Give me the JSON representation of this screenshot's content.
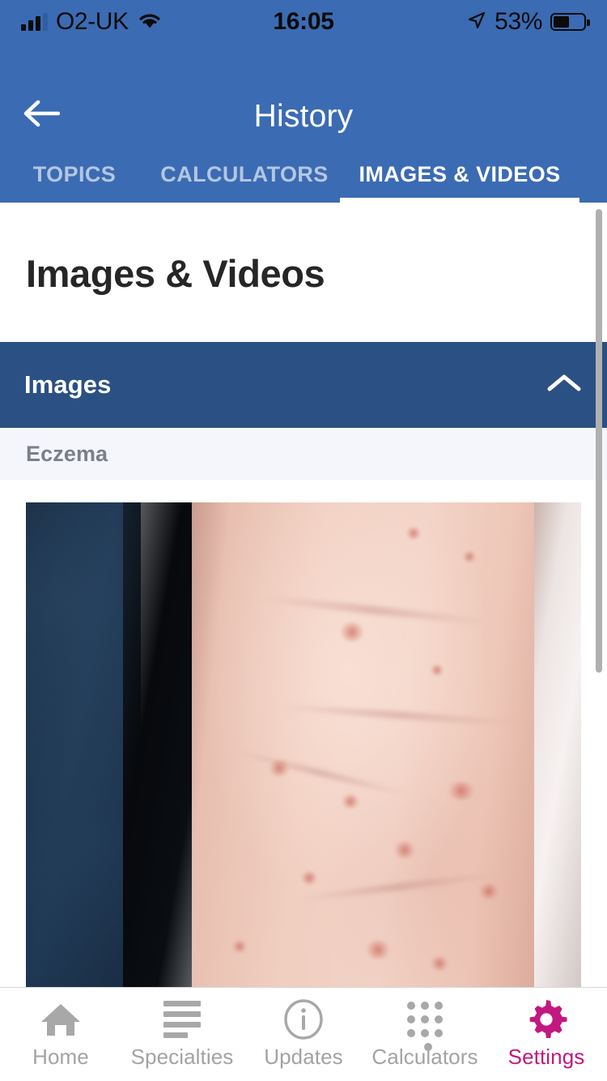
{
  "status_bar": {
    "carrier": "O2-UK",
    "time": "16:05",
    "battery_percent": "53%",
    "wifi_icon": "wifi-icon",
    "location_icon": "location-arrow-icon",
    "signal_icon": "signal-bars-icon",
    "battery_icon": "battery-icon"
  },
  "header": {
    "title": "History",
    "back_icon": "back-arrow-icon",
    "background_color": "#3b6bb3"
  },
  "tabs": [
    {
      "label": "TOPICS",
      "active": false
    },
    {
      "label": "CALCULATORS",
      "active": false
    },
    {
      "label": "IMAGES & VIDEOS",
      "active": true
    }
  ],
  "main": {
    "page_title": "Images & Videos",
    "section": {
      "title": "Images",
      "expanded": true,
      "chevron_icon": "chevron-up-icon",
      "background_color": "#2b5084"
    },
    "caption": "Eczema",
    "image_alt": "Eczema on forearm"
  },
  "bottom_nav": [
    {
      "label": "Home",
      "icon": "home-icon",
      "active": false
    },
    {
      "label": "Specialties",
      "icon": "list-lines-icon",
      "active": false
    },
    {
      "label": "Updates",
      "icon": "info-circle-icon",
      "active": false
    },
    {
      "label": "Calculators",
      "icon": "keypad-dots-icon",
      "active": false
    },
    {
      "label": "Settings",
      "icon": "gear-icon",
      "active": true
    }
  ],
  "colors": {
    "brand_blue": "#3b6bb3",
    "section_blue": "#2b5084",
    "accent_magenta": "#c2187f",
    "inactive_gray": "#a3a3a3"
  }
}
